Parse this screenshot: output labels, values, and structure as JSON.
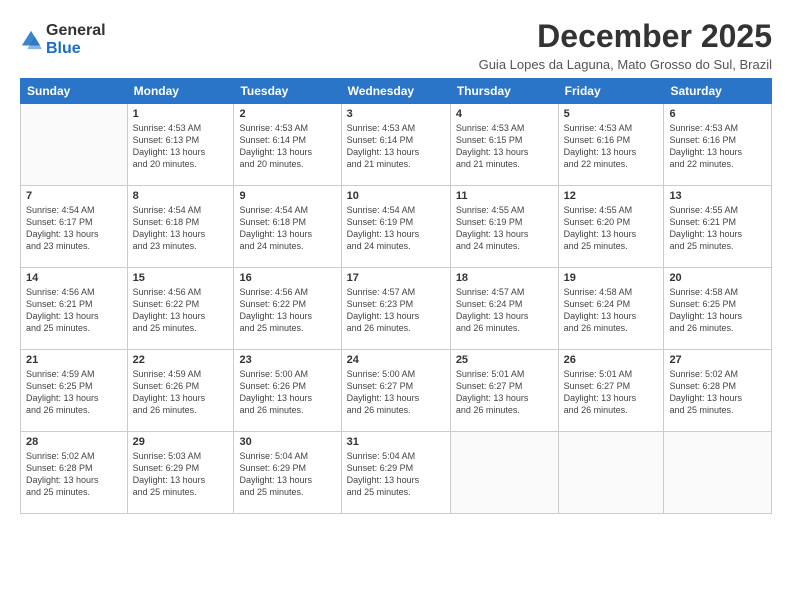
{
  "logo": {
    "general": "General",
    "blue": "Blue"
  },
  "title": "December 2025",
  "subtitle": "Guia Lopes da Laguna, Mato Grosso do Sul, Brazil",
  "headers": [
    "Sunday",
    "Monday",
    "Tuesday",
    "Wednesday",
    "Thursday",
    "Friday",
    "Saturday"
  ],
  "weeks": [
    [
      {
        "day": "",
        "info": ""
      },
      {
        "day": "1",
        "info": "Sunrise: 4:53 AM\nSunset: 6:13 PM\nDaylight: 13 hours\nand 20 minutes."
      },
      {
        "day": "2",
        "info": "Sunrise: 4:53 AM\nSunset: 6:14 PM\nDaylight: 13 hours\nand 20 minutes."
      },
      {
        "day": "3",
        "info": "Sunrise: 4:53 AM\nSunset: 6:14 PM\nDaylight: 13 hours\nand 21 minutes."
      },
      {
        "day": "4",
        "info": "Sunrise: 4:53 AM\nSunset: 6:15 PM\nDaylight: 13 hours\nand 21 minutes."
      },
      {
        "day": "5",
        "info": "Sunrise: 4:53 AM\nSunset: 6:16 PM\nDaylight: 13 hours\nand 22 minutes."
      },
      {
        "day": "6",
        "info": "Sunrise: 4:53 AM\nSunset: 6:16 PM\nDaylight: 13 hours\nand 22 minutes."
      }
    ],
    [
      {
        "day": "7",
        "info": "Sunrise: 4:54 AM\nSunset: 6:17 PM\nDaylight: 13 hours\nand 23 minutes."
      },
      {
        "day": "8",
        "info": "Sunrise: 4:54 AM\nSunset: 6:18 PM\nDaylight: 13 hours\nand 23 minutes."
      },
      {
        "day": "9",
        "info": "Sunrise: 4:54 AM\nSunset: 6:18 PM\nDaylight: 13 hours\nand 24 minutes."
      },
      {
        "day": "10",
        "info": "Sunrise: 4:54 AM\nSunset: 6:19 PM\nDaylight: 13 hours\nand 24 minutes."
      },
      {
        "day": "11",
        "info": "Sunrise: 4:55 AM\nSunset: 6:19 PM\nDaylight: 13 hours\nand 24 minutes."
      },
      {
        "day": "12",
        "info": "Sunrise: 4:55 AM\nSunset: 6:20 PM\nDaylight: 13 hours\nand 25 minutes."
      },
      {
        "day": "13",
        "info": "Sunrise: 4:55 AM\nSunset: 6:21 PM\nDaylight: 13 hours\nand 25 minutes."
      }
    ],
    [
      {
        "day": "14",
        "info": "Sunrise: 4:56 AM\nSunset: 6:21 PM\nDaylight: 13 hours\nand 25 minutes."
      },
      {
        "day": "15",
        "info": "Sunrise: 4:56 AM\nSunset: 6:22 PM\nDaylight: 13 hours\nand 25 minutes."
      },
      {
        "day": "16",
        "info": "Sunrise: 4:56 AM\nSunset: 6:22 PM\nDaylight: 13 hours\nand 25 minutes."
      },
      {
        "day": "17",
        "info": "Sunrise: 4:57 AM\nSunset: 6:23 PM\nDaylight: 13 hours\nand 26 minutes."
      },
      {
        "day": "18",
        "info": "Sunrise: 4:57 AM\nSunset: 6:24 PM\nDaylight: 13 hours\nand 26 minutes."
      },
      {
        "day": "19",
        "info": "Sunrise: 4:58 AM\nSunset: 6:24 PM\nDaylight: 13 hours\nand 26 minutes."
      },
      {
        "day": "20",
        "info": "Sunrise: 4:58 AM\nSunset: 6:25 PM\nDaylight: 13 hours\nand 26 minutes."
      }
    ],
    [
      {
        "day": "21",
        "info": "Sunrise: 4:59 AM\nSunset: 6:25 PM\nDaylight: 13 hours\nand 26 minutes."
      },
      {
        "day": "22",
        "info": "Sunrise: 4:59 AM\nSunset: 6:26 PM\nDaylight: 13 hours\nand 26 minutes."
      },
      {
        "day": "23",
        "info": "Sunrise: 5:00 AM\nSunset: 6:26 PM\nDaylight: 13 hours\nand 26 minutes."
      },
      {
        "day": "24",
        "info": "Sunrise: 5:00 AM\nSunset: 6:27 PM\nDaylight: 13 hours\nand 26 minutes."
      },
      {
        "day": "25",
        "info": "Sunrise: 5:01 AM\nSunset: 6:27 PM\nDaylight: 13 hours\nand 26 minutes."
      },
      {
        "day": "26",
        "info": "Sunrise: 5:01 AM\nSunset: 6:27 PM\nDaylight: 13 hours\nand 26 minutes."
      },
      {
        "day": "27",
        "info": "Sunrise: 5:02 AM\nSunset: 6:28 PM\nDaylight: 13 hours\nand 25 minutes."
      }
    ],
    [
      {
        "day": "28",
        "info": "Sunrise: 5:02 AM\nSunset: 6:28 PM\nDaylight: 13 hours\nand 25 minutes."
      },
      {
        "day": "29",
        "info": "Sunrise: 5:03 AM\nSunset: 6:29 PM\nDaylight: 13 hours\nand 25 minutes."
      },
      {
        "day": "30",
        "info": "Sunrise: 5:04 AM\nSunset: 6:29 PM\nDaylight: 13 hours\nand 25 minutes."
      },
      {
        "day": "31",
        "info": "Sunrise: 5:04 AM\nSunset: 6:29 PM\nDaylight: 13 hours\nand 25 minutes."
      },
      {
        "day": "",
        "info": ""
      },
      {
        "day": "",
        "info": ""
      },
      {
        "day": "",
        "info": ""
      }
    ]
  ]
}
